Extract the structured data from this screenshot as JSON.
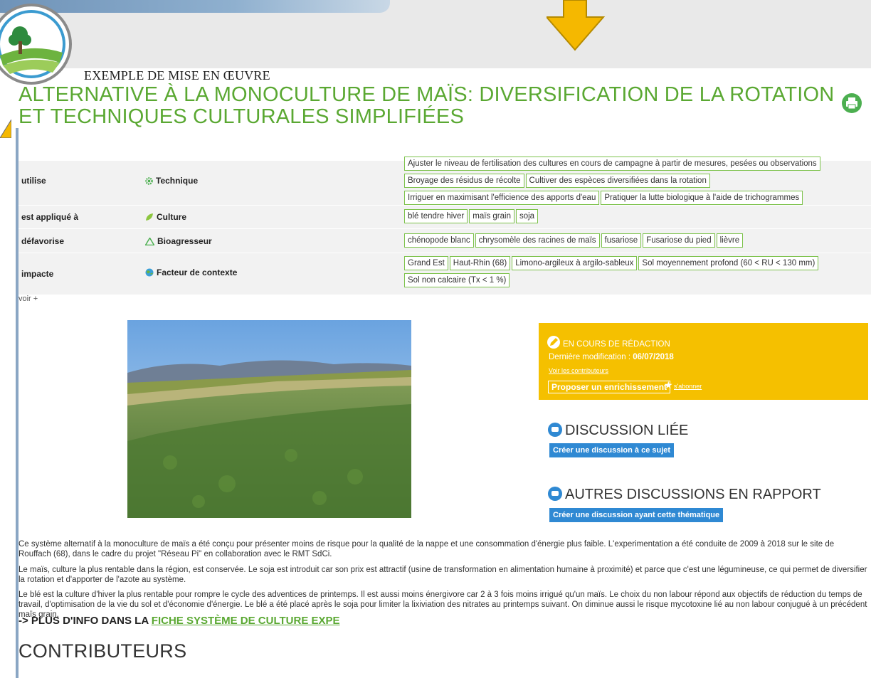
{
  "header": {
    "kicker": "EXEMPLE DE MISE EN ŒUVRE",
    "title": "ALTERNATIVE À LA MONOCULTURE DE MAÏS: DIVERSIFICATION DE LA ROTATION ET TECHNIQUES CULTURALES SIMPLIFIÉES"
  },
  "facts": [
    {
      "predicate": "utilise",
      "type": "Technique",
      "icon": "gear-icon",
      "tags": [
        "Ajuster le niveau de fertilisation des cultures en cours de campagne à partir de mesures, pesées ou observations",
        "Broyage des résidus de récolte",
        "Cultiver des espèces diversifiées dans la rotation",
        "Irriguer en maximisant l'efficience des apports d'eau",
        "Pratiquer la lutte biologique à l'aide de trichogrammes"
      ]
    },
    {
      "predicate": "est appliqué à",
      "type": "Culture",
      "icon": "leaf-icon",
      "tags": [
        "blé tendre hiver",
        "maïs grain",
        "soja"
      ]
    },
    {
      "predicate": "défavorise",
      "type": "Bioagresseur",
      "icon": "warning-icon",
      "tags": [
        "chénopode blanc",
        "chrysomèle des racines de maïs",
        "fusariose",
        "Fusariose du pied",
        "lièvre"
      ]
    },
    {
      "predicate": "impacte",
      "type": "Facteur de contexte",
      "icon": "globe-icon",
      "tags": [
        "Grand Est",
        "Haut-Rhin (68)",
        "Limono-argileux à argilo-sableux",
        "Sol moyennement profond (60 < RU < 130 mm)",
        "Sol non calcaire (Tx < 1 %)"
      ]
    }
  ],
  "voir": "voir +",
  "status": {
    "label": "EN COURS DE RÉDACTION",
    "modif_label": "Dernière modification : ",
    "modif_date": "06/07/2018",
    "contributors_link": "Voir les contributeurs",
    "enrich_button": "Proposer un enrichissement",
    "subscribe": "s'abonner"
  },
  "discussion": {
    "title": "DISCUSSION LIÉE",
    "button": "Créer une discussion à ce sujet"
  },
  "other_discussions": {
    "title": "AUTRES DISCUSSIONS EN RAPPORT",
    "button": "Créer une discussion ayant cette thématique"
  },
  "paragraphs": [
    "Ce système alternatif à la monoculture de maïs a été conçu pour présenter moins de risque pour la qualité de la nappe et une consommation d'énergie plus faible. L'experimentation a été conduite de 2009 à 2018 sur le site de Rouffach (68), dans le cadre du projet \"Réseau Pi\" en collaboration avec le RMT SdCi.",
    "Le maïs, culture la plus rentable dans la région, est conservée. Le soja est introduit car son prix est attractif (usine de transformation en alimentation humaine à proximité) et parce que c'est une légumineuse, ce qui permet de diversifier la rotation et d'apporter de l'azote au système.",
    "Le blé est la culture d'hiver la plus rentable pour rompre le cycle des adventices de printemps. Il est aussi moins énergivore car 2 à 3 fois moins irrigué qu'un maïs. Le choix du non labour répond aux objectifs de réduction du temps de travail, d'optimisation de la vie du sol et d'économie d'énergie. Le blé a été placé après le soja pour limiter la lixiviation des nitrates au printemps suivant. On diminue aussi le risque mycotoxine lié au non labour conjugué à un précédent maïs grain."
  ],
  "more_info": {
    "prefix": "-> PLUS D'INFO DANS LA ",
    "link": "FICHE SYSTÈME DE CULTURE EXPE"
  },
  "contributors_title": "CONTRIBUTEURS",
  "colors": {
    "green": "#5aa832",
    "tag_border": "#7cc24a",
    "yellow": "#f5c000",
    "blue": "#2f89d3"
  }
}
